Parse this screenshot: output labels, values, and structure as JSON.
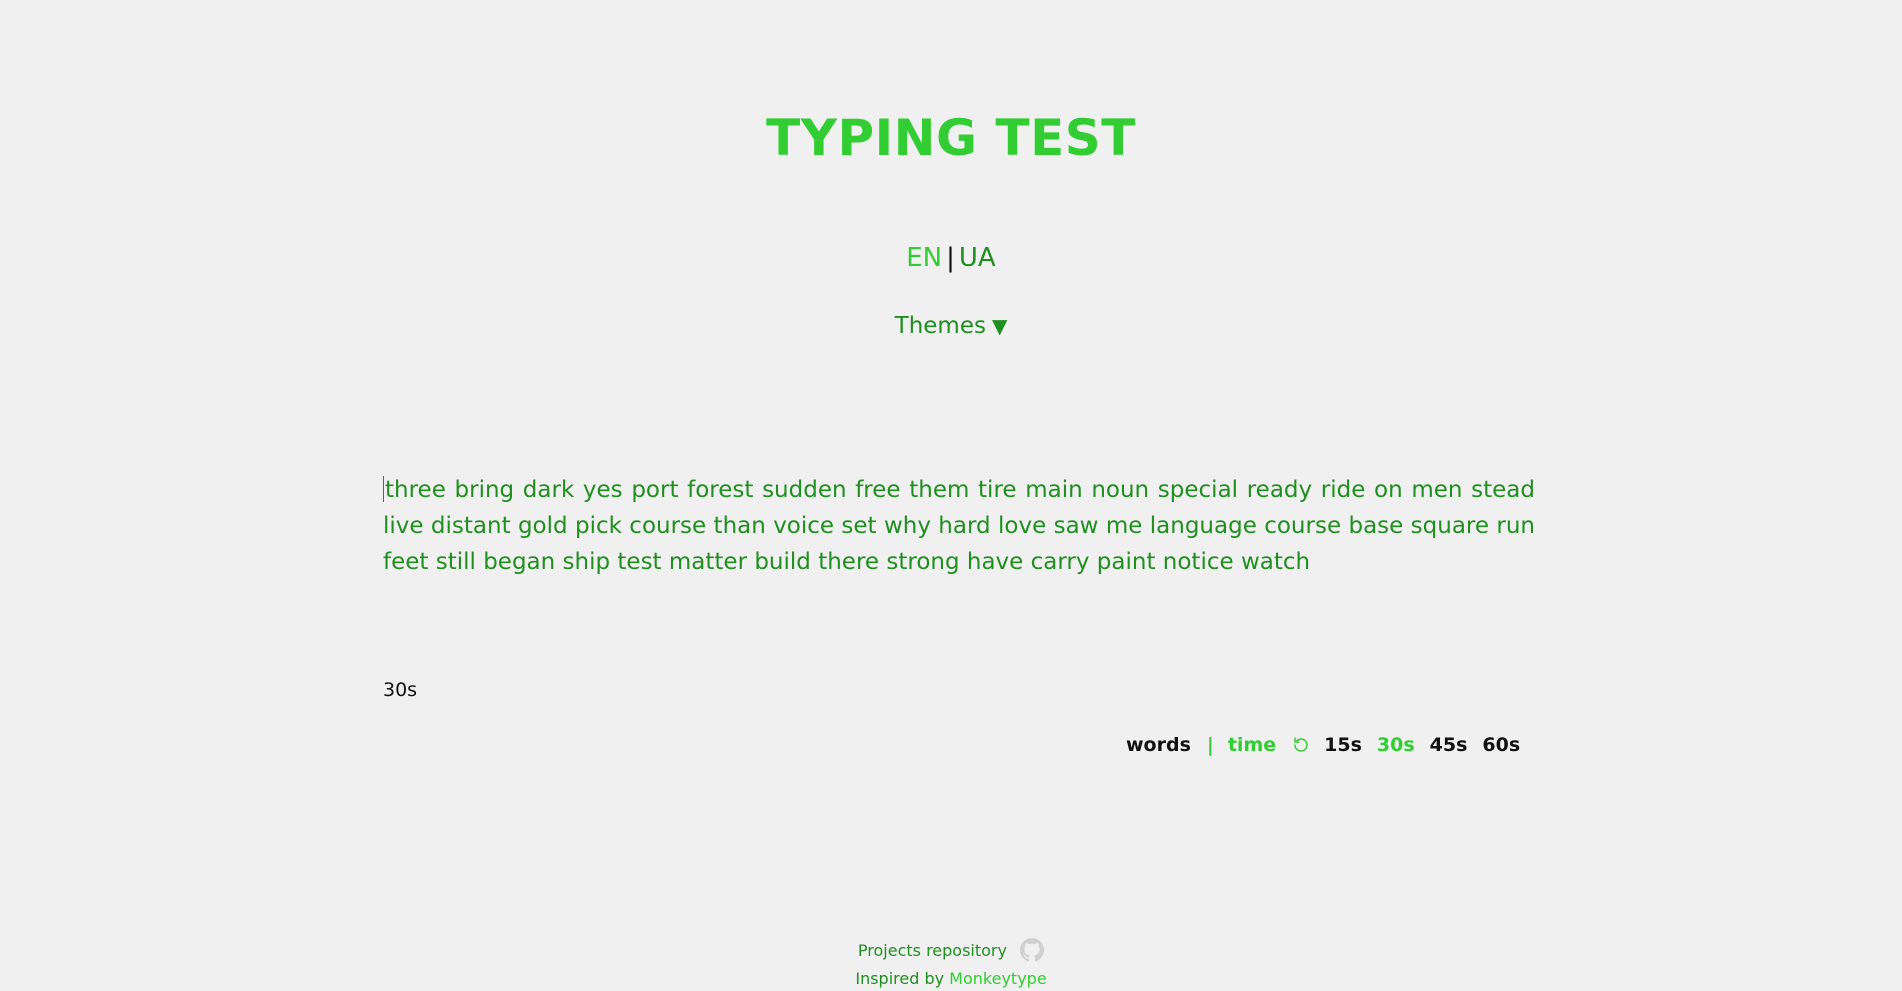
{
  "app": {
    "title": "TYPING TEST"
  },
  "language": {
    "options": [
      "EN",
      "UA"
    ],
    "separator": "|",
    "selected": "EN"
  },
  "themes": {
    "label": "Themes",
    "caret": "▼"
  },
  "test": {
    "words": "three bring dark yes port forest sudden free them tire main noun special ready ride on men stead live distant gold pick course than voice set why hard love saw me language course base square run feet still began ship test matter build there strong have carry paint notice watch",
    "timer": "30s"
  },
  "config": {
    "modes": [
      "words",
      "time"
    ],
    "separator": "|",
    "active_mode": "time",
    "restart_icon": "restart-icon",
    "durations": [
      "15s",
      "30s",
      "45s",
      "60s"
    ],
    "active_duration": "30s"
  },
  "footer": {
    "repo_label": "Projects repository",
    "repo_icon": "github-icon",
    "inspired_prefix": "Inspired by",
    "inspired_link": "Monkeytype"
  },
  "colors": {
    "accent": "#32cd32",
    "text_green": "#1f8f1f",
    "background": "#f0f0f0",
    "dark_text": "#111111",
    "icon_gray": "#d0d0d0"
  }
}
